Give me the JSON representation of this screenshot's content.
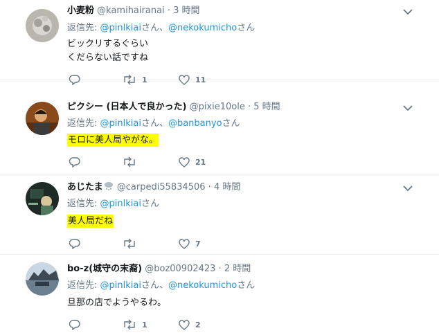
{
  "tweets": [
    {
      "name": "小麦粉",
      "handle": "@kamihairanai",
      "time": "3 時間",
      "reply_prefix": "返信先: ",
      "mentions": [
        "@pinlkiai",
        "@nekokumicho"
      ],
      "mention_sep": "さん、",
      "mention_suffix": "さん",
      "lines": [
        "ビックリするぐらい",
        "くだらない話ですね"
      ],
      "highlight": false,
      "reply_count": "",
      "retweet_count": "1",
      "like_count": "11"
    },
    {
      "name": "ピクシー (日本人で良かった)",
      "handle": "@pixie10ole",
      "time": "5 時間",
      "reply_prefix": "返信先: ",
      "mentions": [
        "@pinlkiai",
        "@banbanyo"
      ],
      "mention_sep": "さん、",
      "mention_suffix": "さん",
      "lines": [
        "モロに美人局やがな。"
      ],
      "highlight": true,
      "reply_count": "",
      "retweet_count": "",
      "like_count": "21"
    },
    {
      "name": "あじたま",
      "handle": "@carpedi55834506",
      "time": "4 時間",
      "reply_prefix": "返信先: ",
      "mentions": [
        "@pinlkiai"
      ],
      "mention_sep": "",
      "mention_suffix": "さん",
      "lines": [
        "美人局だね"
      ],
      "highlight": true,
      "reply_count": "",
      "retweet_count": "",
      "like_count": "7"
    },
    {
      "name": "bo-z(城守の末裔)",
      "handle": "@boz00902423",
      "time": "2 時間",
      "reply_prefix": "返信先: ",
      "mentions": [
        "@pinlkiai",
        "@nekokumicho"
      ],
      "mention_sep": "さん、",
      "mention_suffix": "さん",
      "lines": [
        "旦那の店でようやるわ。"
      ],
      "highlight": false,
      "reply_count": "",
      "retweet_count": "1",
      "like_count": "2"
    }
  ],
  "dot": "·",
  "colors": {
    "link": "#1b95e0",
    "muted": "#657786",
    "highlight": "#ffff00",
    "divider": "#e6ecf0"
  }
}
